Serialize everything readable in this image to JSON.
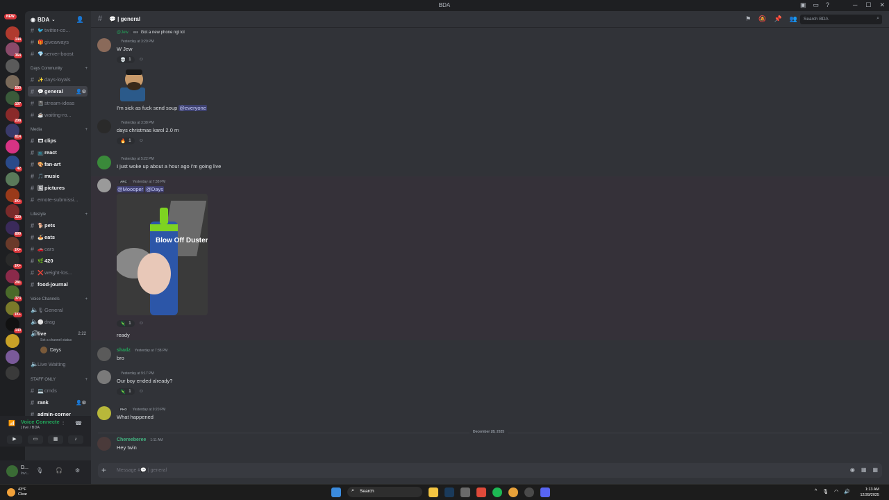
{
  "window": {
    "title": "BDA",
    "controls": [
      "─",
      "☐",
      "✕"
    ]
  },
  "rail": {
    "new_label": "NEW",
    "badges": [
      "144",
      "364",
      "",
      "500",
      "107",
      "208",
      "814",
      "",
      "42",
      "",
      "3K+",
      "329",
      "899",
      "1K+",
      "1K+",
      "281",
      "373",
      "1K+",
      "140",
      "",
      "",
      ""
    ]
  },
  "guild": {
    "name": "BDA"
  },
  "sidebar": {
    "channels_top": [
      {
        "name": "twitter-co...",
        "emoji": "🐦"
      },
      {
        "name": "giveaways",
        "emoji": "🎁"
      },
      {
        "name": "server-boost",
        "emoji": "💎"
      }
    ],
    "cat_days": "Days Community",
    "channels_days": [
      {
        "name": "days-loyals",
        "emoji": "✨"
      },
      {
        "name": "general",
        "emoji": "💬"
      },
      {
        "name": "stream-ideas",
        "emoji": "📓"
      },
      {
        "name": "waiting-ro...",
        "emoji": "☕"
      }
    ],
    "cat_media": "Media",
    "channels_media": [
      {
        "name": "clips",
        "emoji": "🎞"
      },
      {
        "name": "react",
        "emoji": "📺"
      },
      {
        "name": "fan-art",
        "emoji": "🎨"
      },
      {
        "name": "music",
        "emoji": "🎵"
      },
      {
        "name": "pictures",
        "emoji": "🖼"
      },
      {
        "name": "emote-submissi...",
        "emoji": ""
      }
    ],
    "cat_lifestyle": "Lifestyle",
    "channels_life": [
      {
        "name": "pets",
        "emoji": "🐕"
      },
      {
        "name": "eats",
        "emoji": "🍝"
      },
      {
        "name": "cars",
        "emoji": "🚗"
      },
      {
        "name": "420",
        "emoji": "🌿"
      },
      {
        "name": "weight-los...",
        "emoji": "❌"
      },
      {
        "name": "food-journal",
        "emoji": ""
      }
    ],
    "cat_voice": "Voice Channels",
    "voice": [
      {
        "name": "General",
        "emoji": "🎙"
      },
      {
        "name": "drag",
        "emoji": "⚪"
      },
      {
        "name": "live",
        "emoji": "",
        "duration": "2:22"
      }
    ],
    "voice_status": "Set a channel status",
    "voice_user": "Days",
    "live_waiting": "Live Waiting",
    "cat_staff": "STAFF ONLY",
    "staff": [
      {
        "name": "cmds",
        "emoji": "💻"
      },
      {
        "name": "rank",
        "emoji": ""
      },
      {
        "name": "admin-corner",
        "emoji": ""
      }
    ]
  },
  "voice_panel": {
    "status": "Voice Connecte",
    "sub": "| live / BDA"
  },
  "user_panel": {
    "name": "D...",
    "sub": "Invi..."
  },
  "header": {
    "channel": "💬 | general",
    "search_placeholder": "Search BDA"
  },
  "messages": {
    "reply_top": {
      "author": "@Jew",
      "tag": "888",
      "text": "Got a new phone ngl lol"
    },
    "m1": {
      "author": "",
      "time": "Yesterday at 3:29 PM",
      "text": "W Jew",
      "react_emoji": "💀",
      "react_count": "1"
    },
    "m1b": {
      "text_pre": "I'm sick as fuck send soup ",
      "mention": "@everyone"
    },
    "m2": {
      "author": "",
      "time": "Yesterday at 3:38 PM",
      "text": "days christmas karol 2.0 rn",
      "react_emoji": "🔥",
      "react_count": "1"
    },
    "m3": {
      "author": "",
      "time": "Yesterday at 5:22 PM",
      "text": "I just woke up about a hour ago I'm going live"
    },
    "m4": {
      "author": "",
      "tag": "ARC",
      "time": "Yesterday at 7:38 PM",
      "mention1": "@Moooper",
      "mention2": "@Days",
      "can_label": "Blow Off Duster",
      "react_emoji": "🦎",
      "react_count": "1",
      "text_after": "ready"
    },
    "m5": {
      "author": "shadz",
      "time": "Yesterday at 7:38 PM",
      "text": "bro"
    },
    "m6": {
      "author": "",
      "time": "Yesterday at 9:17 PM",
      "text": "Our boy ended already?",
      "react_emoji": "🦎",
      "react_count": "1"
    },
    "m7": {
      "author": "",
      "tag": "PHO",
      "time": "Yesterday at 9:20 PM",
      "text": "What happened"
    },
    "divider": "December 28, 2025",
    "m8": {
      "author": "Chereeberee",
      "time": "1:11 AM",
      "text": "Hey twin"
    }
  },
  "composer": {
    "placeholder": "Message #💬 | general"
  },
  "taskbar": {
    "temp": "43°F",
    "cond": "Clear",
    "search": "Search",
    "time": "1:13 AM",
    "date": "12/28/2025"
  }
}
